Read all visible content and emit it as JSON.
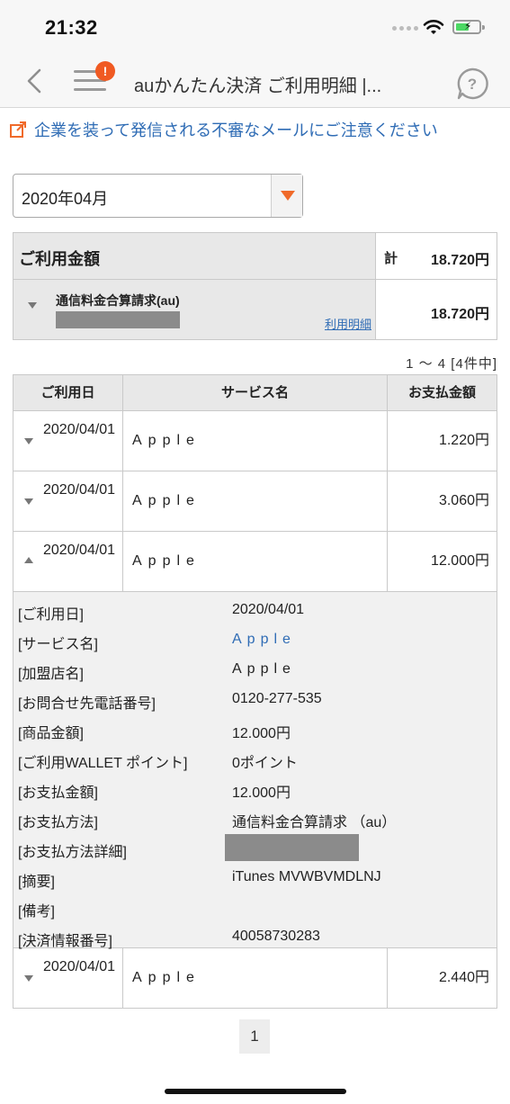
{
  "status_bar": {
    "time": "21:32"
  },
  "nav": {
    "title": "auかんたん決済 ご利用明細 |...",
    "badge": "!"
  },
  "warning": {
    "text": "企業を装って発信される不審なメールにご注意ください"
  },
  "month_select": {
    "value": "2020年04月"
  },
  "summary": {
    "title": "ご利用金額",
    "total_prefix": "計",
    "total": "18.720円",
    "item_label": "通信料金合算請求(au)",
    "item_link": "利用明細",
    "item_amount": "18.720円"
  },
  "count_text": "1 ～ 4 [4件中]",
  "table": {
    "headers": {
      "date": "ご利用日",
      "service": "サービス名",
      "amount": "お支払金額"
    },
    "rows": [
      {
        "date": "2020/04/01",
        "service": "Apple",
        "amount": "1.220円",
        "expanded": false
      },
      {
        "date": "2020/04/01",
        "service": "Apple",
        "amount": "3.060円",
        "expanded": false
      },
      {
        "date": "2020/04/01",
        "service": "Apple",
        "amount": "12.000円",
        "expanded": true
      },
      {
        "date": "2020/04/01",
        "service": "Apple",
        "amount": "2.440円",
        "expanded": false
      }
    ]
  },
  "detail": [
    {
      "label": "[ご利用日]",
      "value": "2020/04/01"
    },
    {
      "label": "[サービス名]",
      "value": "Apple"
    },
    {
      "label": "[加盟店名]",
      "value": "Apple"
    },
    {
      "label": "[お問合せ先電話番号]",
      "value": "0120-277-535"
    },
    {
      "label": "[商品金額]",
      "value": "12.000円"
    },
    {
      "label": "[ご利用WALLET ポイント]",
      "value": "0ポイント"
    },
    {
      "label": "[お支払金額]",
      "value": "12.000円"
    },
    {
      "label": "[お支払方法]",
      "value": "通信料金合算請求 （au）"
    },
    {
      "label": "[お支払方法詳細]",
      "value": ""
    },
    {
      "label": "[摘要]",
      "value": "iTunes MVWBVMDLNJ"
    },
    {
      "label": "[備考]",
      "value": ""
    },
    {
      "label": "[決済情報番号]",
      "value": "40058730283"
    }
  ],
  "pager": {
    "current": "1"
  },
  "colors": {
    "accent": "#f06a2a",
    "link": "#2f6cb5",
    "header_bg": "#e8e8e8"
  },
  "icons": [
    "back-chevron-icon",
    "menu-icon",
    "help-icon",
    "external-link-icon",
    "dropdown-arrow-icon",
    "wifi-icon",
    "battery-icon"
  ]
}
